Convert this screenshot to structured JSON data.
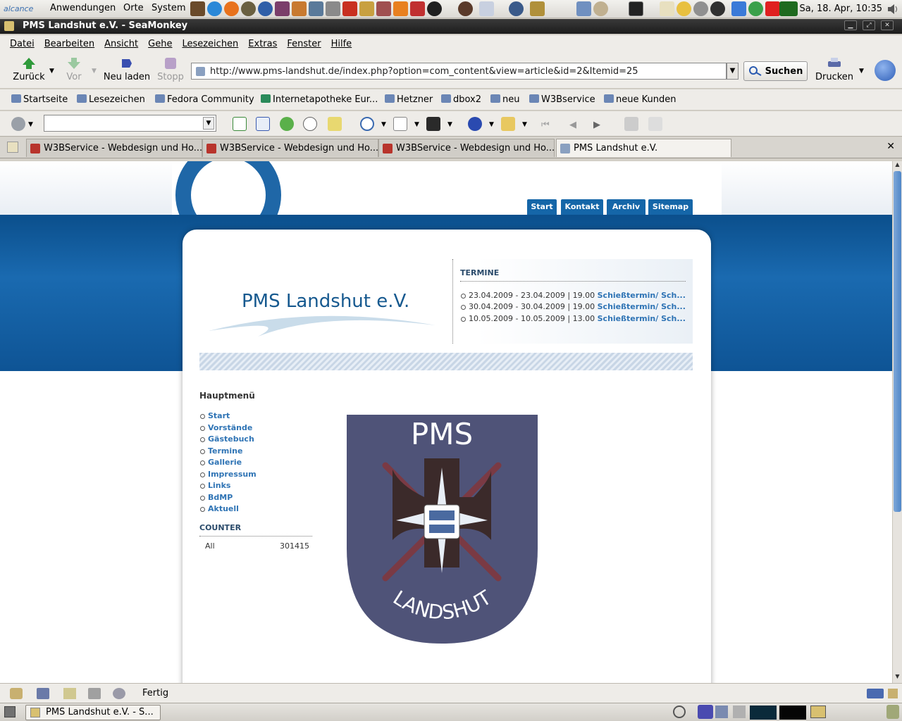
{
  "gnome_panel": {
    "brand": "alcance",
    "menus": [
      "Anwendungen",
      "Orte",
      "System"
    ],
    "clock": "Sa, 18. Apr, 10:35"
  },
  "window": {
    "title": "PMS Landshut e.V. - SeaMonkey"
  },
  "menubar": [
    "Datei",
    "Bearbeiten",
    "Ansicht",
    "Gehe",
    "Lesezeichen",
    "Extras",
    "Fenster",
    "Hilfe"
  ],
  "navigation": {
    "back": "Zurück",
    "forward": "Vor",
    "reload": "Neu laden",
    "stop": "Stopp",
    "url": "http://www.pms-landshut.de/index.php?option=com_content&view=article&id=2&Itemid=25",
    "search": "Suchen",
    "print": "Drucken"
  },
  "bookmarks": [
    "Startseite",
    "Lesezeichen",
    "Fedora Community",
    "Internetapotheke Eur...",
    "Hetzner",
    "dbox2",
    "neu",
    "W3Bservice",
    "neue Kunden"
  ],
  "tabs": [
    {
      "label": "W3BService - Webdesign und Ho..."
    },
    {
      "label": "W3BService - Webdesign und Ho..."
    },
    {
      "label": "W3BService - Webdesign und Ho..."
    },
    {
      "label": "PMS Landshut e.V."
    }
  ],
  "page": {
    "nav": [
      "Start",
      "Kontakt",
      "Archiv",
      "Sitemap"
    ],
    "site_title": "PMS Landshut e.V.",
    "termine": {
      "heading": "TERMINE",
      "items": [
        {
          "date": "23.04.2009 - 23.04.2009 | 19.00",
          "link": "Schießtermin/ Sch..."
        },
        {
          "date": "30.04.2009 - 30.04.2009 | 19.00",
          "link": "Schießtermin/ Sch..."
        },
        {
          "date": "10.05.2009 - 10.05.2009 | 13.00",
          "link": "Schießtermin/ Sch..."
        }
      ]
    },
    "main_menu": {
      "heading": "Hauptmenü",
      "items": [
        "Start",
        "Vorstände",
        "Gästebuch",
        "Termine",
        "Gallerie",
        "Impressum",
        "Links",
        "BdMP",
        "Aktuell"
      ]
    },
    "counter": {
      "heading": "COUNTER",
      "label": "All",
      "value": "301415"
    },
    "emblem": {
      "top": "PMS",
      "bottom": "LANDSHUT",
      "colors": {
        "shield": "#4f5378",
        "cross": "#3b2a2a"
      }
    }
  },
  "status": {
    "text": "Fertig"
  },
  "taskbar": {
    "window_button": "PMS Landshut e.V. - S..."
  },
  "colors": {
    "site_blue": "#1566a8",
    "link_blue": "#2f74b5"
  }
}
